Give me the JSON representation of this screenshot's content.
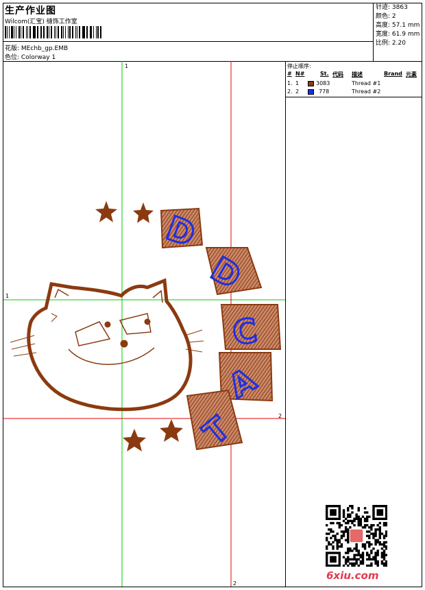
{
  "header": {
    "title": "生产作业图",
    "company": "Wilcom(汇宝) 缝饰工作室",
    "design_label": "花版:",
    "design_value": "MEchb_gp.EMB",
    "colorway_label": "色位:",
    "colorway_value": "Colorway 1"
  },
  "stats": [
    {
      "label": "针迹:",
      "value": "3863"
    },
    {
      "label": "颜色:",
      "value": "2"
    },
    {
      "label": "高度:",
      "value": "57.1 mm"
    },
    {
      "label": "宽度:",
      "value": "61.9 mm"
    },
    {
      "label": "比例:",
      "value": "2.20"
    }
  ],
  "stop_sequence": {
    "title": "停止顺序:",
    "columns": [
      "#",
      "N#",
      "St.",
      "代码",
      "描述",
      "Brand",
      "元素"
    ],
    "rows": [
      {
        "num": "1.",
        "n": "1",
        "code": "3083",
        "desc": "Thread #1",
        "color": "#8b3a10"
      },
      {
        "num": "2.",
        "n": "2",
        "code": "778",
        "desc": "Thread #2",
        "color": "#1e2ee6"
      }
    ]
  },
  "canvas": {
    "axis_labels": {
      "green_v": "1",
      "green_h": "1",
      "red_h": "2",
      "red_v": "2"
    },
    "letters": [
      "D",
      "D",
      "C",
      "A",
      "T"
    ]
  },
  "colors": {
    "thread1": "#8b3a10",
    "thread2": "#1e2ee6",
    "green_axis": "#00cc00",
    "red_axis": "#e00000"
  },
  "watermark": "6xiu.com"
}
